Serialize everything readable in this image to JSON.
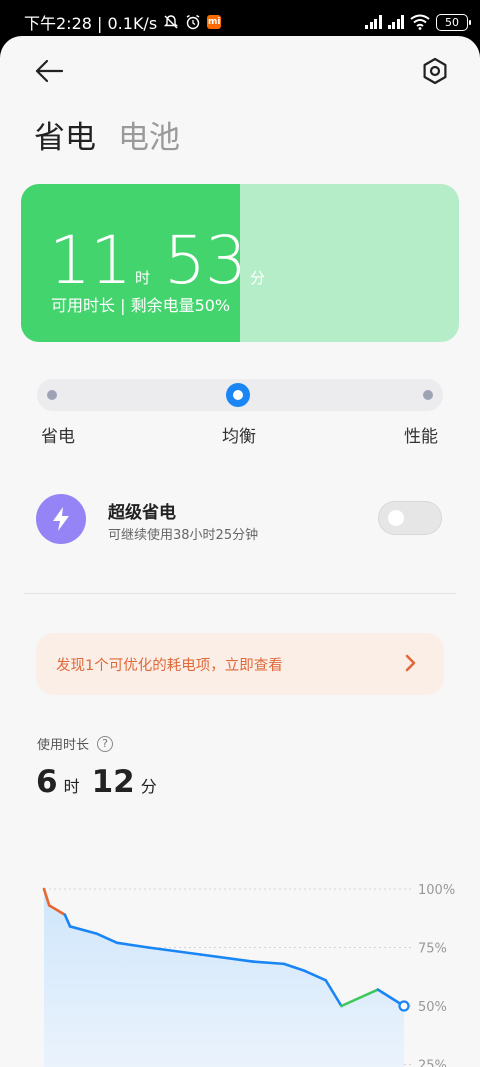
{
  "status_bar": {
    "time_text": "下午2:28 | 0.1K/s",
    "carrier_icon": "mi-icon",
    "carrier_text": "mi",
    "battery_level": "50"
  },
  "header": {
    "tabs": [
      {
        "label": "省电",
        "active": true
      },
      {
        "label": "电池",
        "active": false
      }
    ]
  },
  "battery_card": {
    "hours": "11",
    "hours_unit": "时",
    "minutes": "53",
    "minutes_unit": "分",
    "subtitle": "可用时长 | 剩余电量50%",
    "remaining_fraction": 0.5,
    "fill_color": "#43d46e",
    "bg_color": "#b4edc8"
  },
  "mode_slider": {
    "options": [
      "省电",
      "均衡",
      "性能"
    ],
    "selected": "均衡"
  },
  "ultra_saver": {
    "title": "超级省电",
    "subtitle": "可继续使用38小时25分钟",
    "enabled": false
  },
  "tip": {
    "text": "发现1个可优化的耗电项，立即查看"
  },
  "usage": {
    "label": "使用时长",
    "hours": "6",
    "hours_unit": "时",
    "minutes": "12",
    "minutes_unit": "分"
  },
  "chart_data": {
    "type": "area",
    "ylim": [
      0,
      100
    ],
    "yticks": [
      "100%",
      "75%",
      "50%",
      "25%"
    ],
    "line_color": "#1a86f5",
    "discharge_color": "#e8662f",
    "charge_color": "#3dc95a",
    "points": [
      {
        "t": 0,
        "level": 100
      },
      {
        "t": 0.1,
        "level": 93
      },
      {
        "t": 0.4,
        "level": 89
      },
      {
        "t": 0.5,
        "level": 84
      },
      {
        "t": 1.0,
        "level": 81
      },
      {
        "t": 1.4,
        "level": 77
      },
      {
        "t": 2.0,
        "level": 75
      },
      {
        "t": 3.0,
        "level": 72
      },
      {
        "t": 4.0,
        "level": 69
      },
      {
        "t": 4.6,
        "level": 68
      },
      {
        "t": 5.0,
        "level": 65
      },
      {
        "t": 5.4,
        "level": 61
      },
      {
        "t": 5.7,
        "level": 50
      },
      {
        "t": 6.4,
        "level": 57
      },
      {
        "t": 6.9,
        "level": 50
      }
    ],
    "discharge_spans": [
      [
        0,
        0.4
      ],
      [
        0.55,
        0.65
      ]
    ],
    "charge_spans": [
      [
        5.7,
        6.4
      ]
    ],
    "current_level": 50
  }
}
